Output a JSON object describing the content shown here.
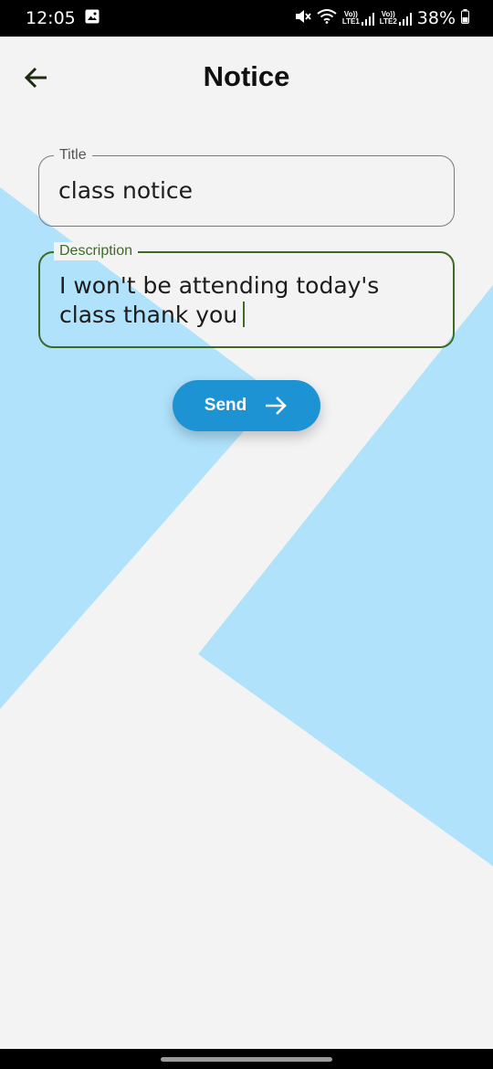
{
  "status_bar": {
    "time": "12:05",
    "battery": "38%",
    "sim1_label": "LTE1",
    "sim2_label": "LTE2",
    "volte_label": "Vo))"
  },
  "header": {
    "title": "Notice",
    "back_icon": "arrow-left-icon"
  },
  "form": {
    "title_label": "Title",
    "title_value": "class notice",
    "description_label": "Description",
    "description_value": "I won't be attending today's class thank you",
    "send_label": "Send",
    "send_icon": "arrow-right-icon"
  },
  "colors": {
    "background": "#f3f3f3",
    "shape_blue": "#b0e2fc",
    "accent_green": "#3e6a26",
    "button_blue": "#1d93d4"
  }
}
